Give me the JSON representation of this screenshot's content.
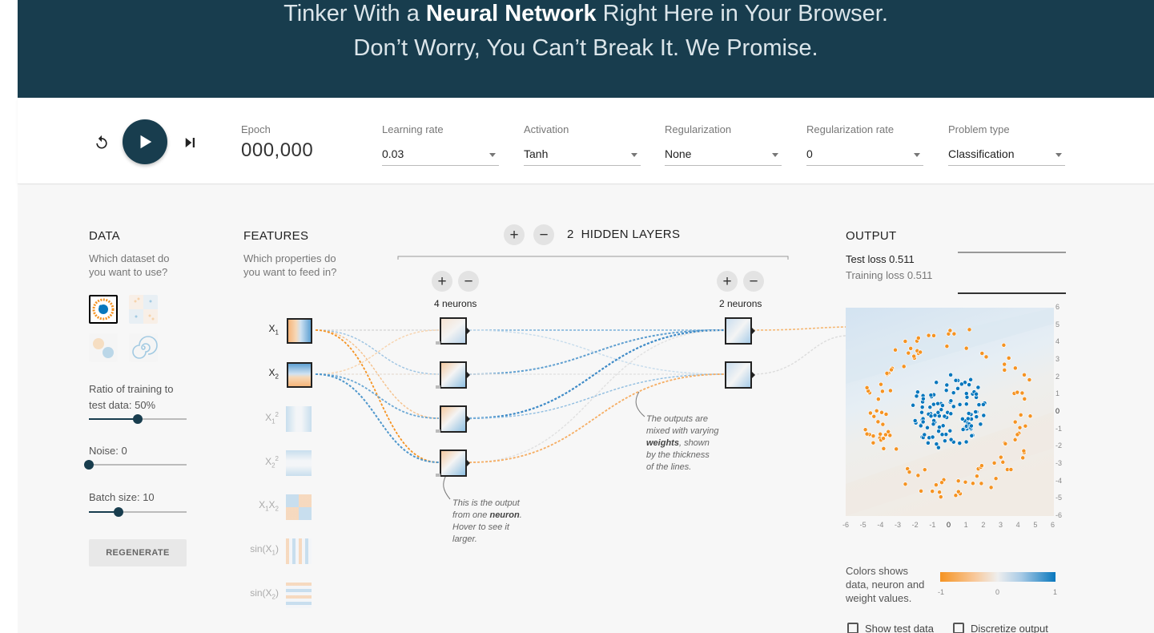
{
  "header": {
    "line1_pre": "Tinker With a ",
    "line1_bold": "Neural Network",
    "line1_post": " Right Here in Your Browser.",
    "line2": "Don’t Worry, You Can’t Break It. We Promise."
  },
  "controls": {
    "epoch_label": "Epoch",
    "epoch_value": "000,000",
    "learning_rate": {
      "label": "Learning rate",
      "value": "0.03"
    },
    "activation": {
      "label": "Activation",
      "value": "Tanh"
    },
    "regularization": {
      "label": "Regularization",
      "value": "None"
    },
    "regularization_rate": {
      "label": "Regularization rate",
      "value": "0"
    },
    "problem_type": {
      "label": "Problem type",
      "value": "Classification"
    }
  },
  "data_panel": {
    "title": "DATA",
    "subtitle1": "Which dataset do",
    "subtitle2": "you want to use?",
    "ratio_label1": "Ratio of training to",
    "ratio_label2": "test data:  50%",
    "ratio_value": 0.5,
    "noise_label": "Noise:  0",
    "noise_value": 0,
    "batch_label": "Batch size:  10",
    "batch_value": 0.3,
    "regenerate_label": "REGENERATE"
  },
  "features_panel": {
    "title": "FEATURES",
    "subtitle1": "Which properties do",
    "subtitle2": "you want to feed in?"
  },
  "network": {
    "hidden_layers_count": "2",
    "hidden_layers_label": "HIDDEN LAYERS",
    "layer1_neurons": "4 neurons",
    "layer2_neurons": "2 neurons",
    "annotation_neuron_1": "This is the output",
    "annotation_neuron_2a": "from one ",
    "annotation_neuron_2b": "neuron",
    "annotation_neuron_2c": ".",
    "annotation_neuron_3": "Hover to see it",
    "annotation_neuron_4": "larger.",
    "annotation_weights_1": "The outputs are",
    "annotation_weights_2": "mixed with varying",
    "annotation_weights_3a": "weights",
    "annotation_weights_3b": ", shown",
    "annotation_weights_4": "by the thickness",
    "annotation_weights_5": "of the lines."
  },
  "output_panel": {
    "title": "OUTPUT",
    "test_loss": "Test loss 0.511",
    "training_loss": "Training loss 0.511",
    "legend_1": "Colors shows",
    "legend_2": "data, neuron and",
    "legend_3": "weight values.",
    "legend_min": "-1",
    "legend_mid": "0",
    "legend_max": "1",
    "show_test_data": "Show test data",
    "discretize_output": "Discretize output",
    "x_ticks": [
      "-6",
      "-5",
      "-4",
      "-3",
      "-2",
      "-1",
      "0",
      "1",
      "2",
      "3",
      "4",
      "5",
      "6"
    ],
    "y_ticks": [
      "6",
      "5",
      "4",
      "3",
      "2",
      "1",
      "0",
      "-1",
      "-2",
      "-3",
      "-4",
      "-5",
      "-6"
    ]
  },
  "colors": {
    "header_bg": "#183d4e",
    "positive": "#0877bd",
    "negative": "#f59322"
  }
}
